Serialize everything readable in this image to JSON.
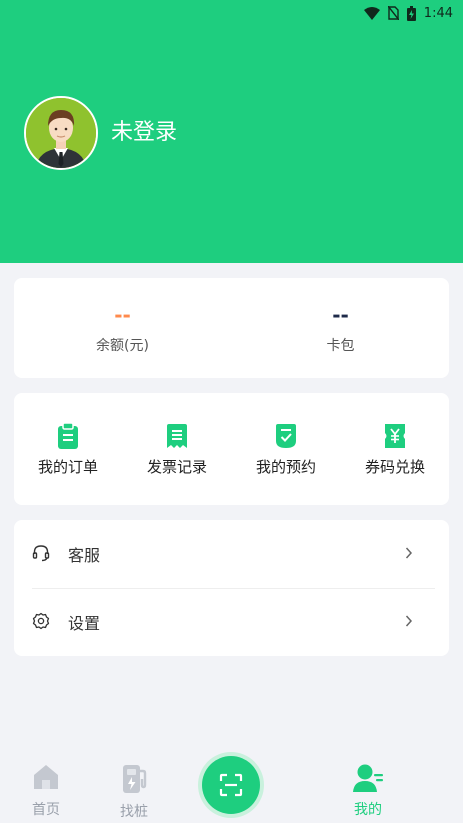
{
  "status_bar": {
    "time": "1:44"
  },
  "profile": {
    "login_text": "未登录"
  },
  "balance": {
    "value": "--",
    "label": "余额(元)",
    "value_color": "#ff8a4c"
  },
  "cards": {
    "value": "--",
    "label": "卡包",
    "value_color": "#1e2a4a"
  },
  "shortcuts": [
    {
      "label": "我的订单",
      "icon": "clipboard-icon"
    },
    {
      "label": "发票记录",
      "icon": "receipt-icon"
    },
    {
      "label": "我的预约",
      "icon": "check-shield-icon"
    },
    {
      "label": "券码兑换",
      "icon": "coupon-icon"
    }
  ],
  "menu": {
    "service": {
      "label": "客服",
      "icon": "headset-icon"
    },
    "settings": {
      "label": "设置",
      "icon": "gear-icon"
    }
  },
  "tabbar": {
    "home": "首页",
    "find_pile": "找桩",
    "mine": "我的"
  },
  "colors": {
    "brand": "#1ece7f",
    "tab_inactive": "#9aa0ab",
    "tab_active": "#1ece7f"
  }
}
